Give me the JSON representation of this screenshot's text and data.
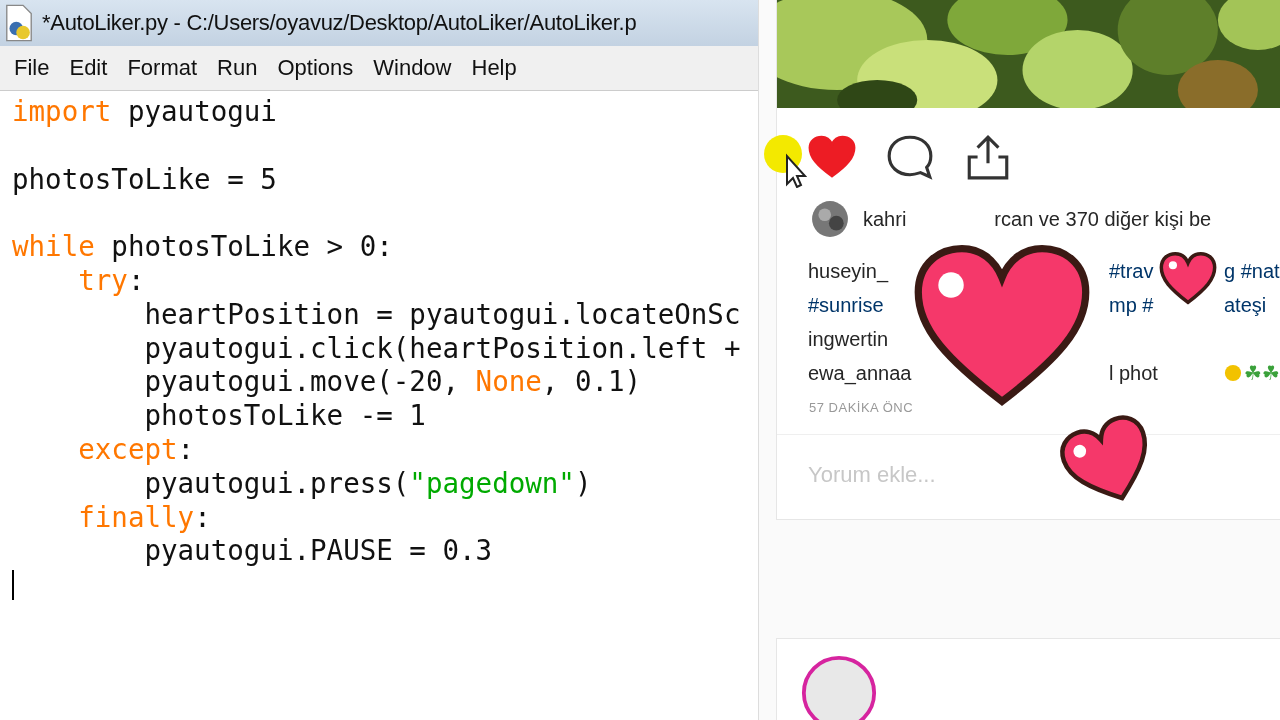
{
  "editor": {
    "title": "*AutoLiker.py - C:/Users/oyavuz/Desktop/AutoLiker/AutoLiker.p",
    "menu": [
      "File",
      "Edit",
      "Format",
      "Run",
      "Options",
      "Window",
      "Help"
    ],
    "code_lines": [
      {
        "kind": "code",
        "tokens": [
          {
            "kind": "keyword",
            "text": "import"
          },
          {
            "kind": "plain",
            "text": " pyautogui"
          }
        ]
      },
      {
        "kind": "blank"
      },
      {
        "kind": "code",
        "tokens": [
          {
            "kind": "plain",
            "text": "photosToLike = 5"
          }
        ]
      },
      {
        "kind": "blank"
      },
      {
        "kind": "code",
        "tokens": [
          {
            "kind": "keyword",
            "text": "while"
          },
          {
            "kind": "plain",
            "text": " photosToLike > 0:"
          }
        ]
      },
      {
        "kind": "code",
        "tokens": [
          {
            "kind": "keyword",
            "text": "    try"
          },
          {
            "kind": "plain",
            "text": ":"
          }
        ]
      },
      {
        "kind": "code",
        "tokens": [
          {
            "kind": "plain",
            "text": "        heartPosition = pyautogui.locateOnSc"
          }
        ]
      },
      {
        "kind": "code",
        "tokens": [
          {
            "kind": "plain",
            "text": "        pyautogui.click(heartPosition.left +"
          }
        ]
      },
      {
        "kind": "code",
        "tokens": [
          {
            "kind": "plain",
            "text": "        pyautogui.move(-20, "
          },
          {
            "kind": "keyword",
            "text": "None"
          },
          {
            "kind": "plain",
            "text": ", 0.1)"
          }
        ]
      },
      {
        "kind": "code",
        "tokens": [
          {
            "kind": "plain",
            "text": "        photosToLike -= 1"
          }
        ]
      },
      {
        "kind": "code",
        "tokens": [
          {
            "kind": "keyword",
            "text": "    except"
          },
          {
            "kind": "plain",
            "text": ":"
          }
        ]
      },
      {
        "kind": "code",
        "tokens": [
          {
            "kind": "plain",
            "text": "        pyautogui.press("
          },
          {
            "kind": "string",
            "text": "\"pagedown\""
          },
          {
            "kind": "plain",
            "text": ")"
          }
        ]
      },
      {
        "kind": "code",
        "tokens": [
          {
            "kind": "keyword",
            "text": "    finally"
          },
          {
            "kind": "plain",
            "text": ":"
          }
        ]
      },
      {
        "kind": "code",
        "tokens": [
          {
            "kind": "plain",
            "text": "        pyautogui.PAUSE = 0.3"
          }
        ]
      },
      {
        "kind": "cursor"
      }
    ]
  },
  "post": {
    "liked": true,
    "likes": [
      "kahri",
      "rcan ve 370 diğer kişi be"
    ],
    "caption_lines": [
      [
        {
          "kind": "user",
          "text": "huseyin_"
        },
        {
          "kind": "tag",
          "text": "#trav"
        },
        {
          "kind": "tag",
          "text": "g #nat"
        }
      ],
      [
        {
          "kind": "tag",
          "text": "#sunrise"
        },
        {
          "kind": "tag",
          "text": "mp #"
        },
        {
          "kind": "tag",
          "text": "ateşi"
        }
      ],
      [
        {
          "kind": "user",
          "text": "ingwertin"
        }
      ],
      [
        {
          "kind": "user",
          "text": "ewa_annaa"
        },
        {
          "kind": "plain",
          "text": "l phot"
        },
        {
          "kind": "emoji",
          "text": "☘☘"
        }
      ]
    ],
    "time": "57 DAKİKA ÖNC",
    "comment": {
      "placeholder": "Yorum ekle..."
    }
  }
}
